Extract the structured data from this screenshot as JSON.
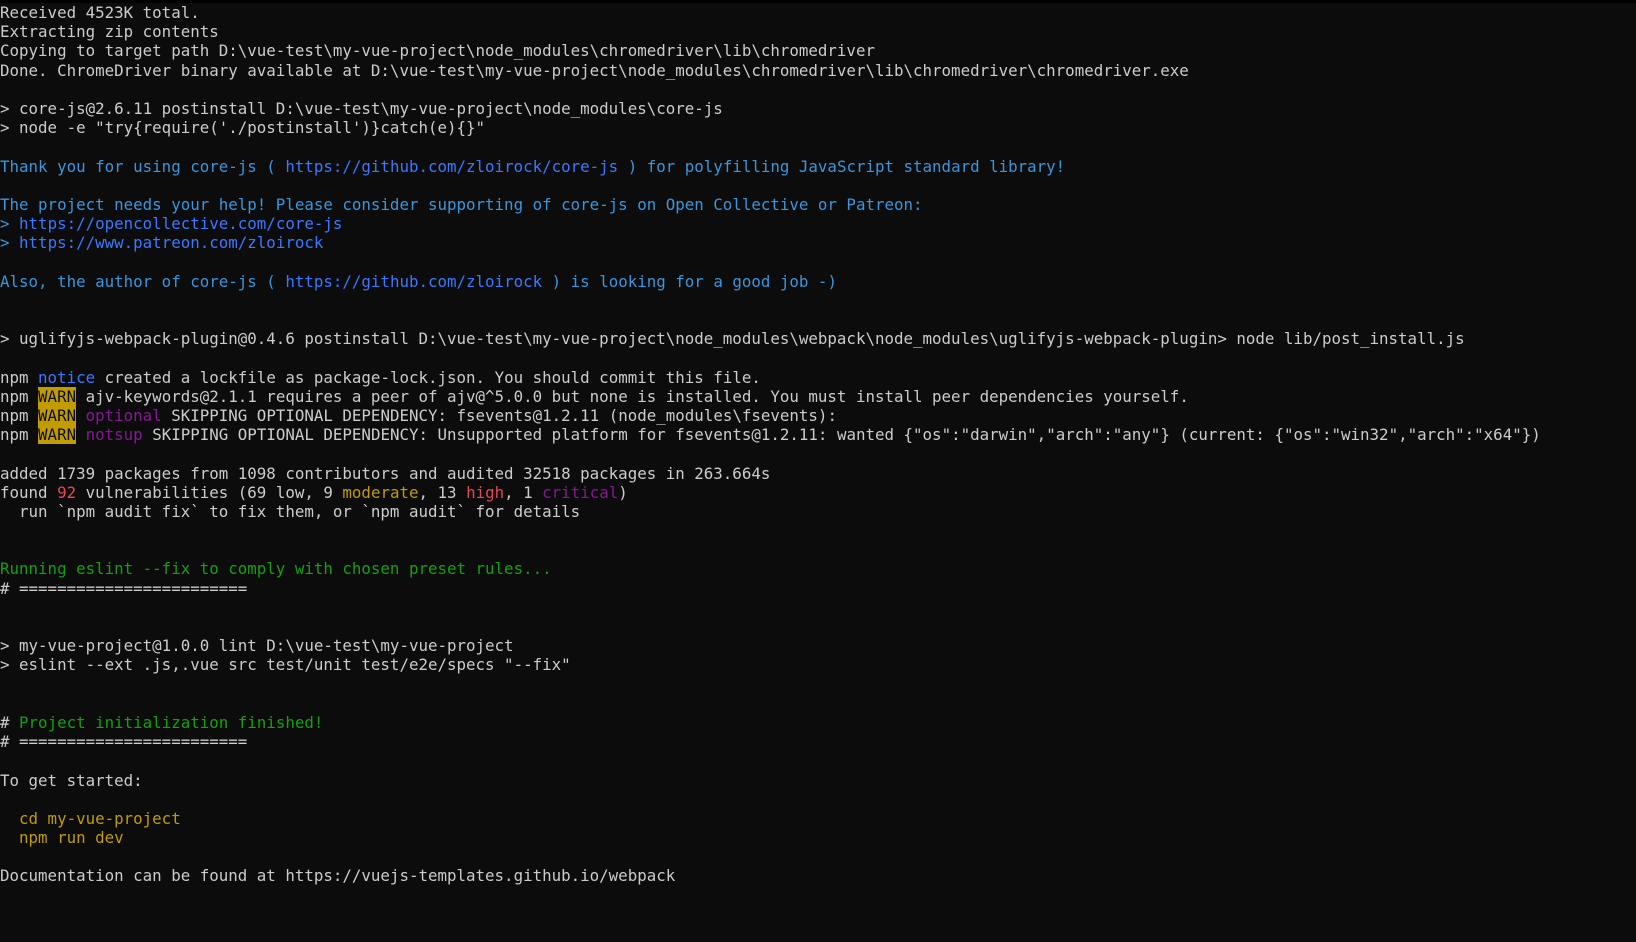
{
  "colors": {
    "background": "#0c0c0c",
    "default": "#cccccc",
    "cyan": "#3a96dd",
    "green": "#13a10e",
    "yellow": "#c19c00",
    "magenta": "#881798",
    "red": "#e74856",
    "notice": "#3b78ff"
  },
  "terminal": {
    "lines": [
      [
        {
          "t": "Received 4523K total.",
          "c": "default"
        }
      ],
      [
        {
          "t": "Extracting zip contents",
          "c": "default"
        }
      ],
      [
        {
          "t": "Copying to target path D:\\vue-test\\my-vue-project\\node_modules\\chromedriver\\lib\\chromedriver",
          "c": "default"
        }
      ],
      [
        {
          "t": "Done. ChromeDriver binary available at D:\\vue-test\\my-vue-project\\node_modules\\chromedriver\\lib\\chromedriver\\chromedriver.exe",
          "c": "default"
        }
      ],
      [],
      [
        {
          "t": "> core-js@2.6.11 postinstall D:\\vue-test\\my-vue-project\\node_modules\\core-js",
          "c": "default"
        }
      ],
      [
        {
          "t": "> node -e \"try{require('./postinstall')}catch(e){}\"",
          "c": "default"
        }
      ],
      [],
      [
        {
          "t": "Thank you for using core-js ( ",
          "c": "cyan"
        },
        {
          "t": "https://github.com/zloirock/core-js",
          "c": "notice"
        },
        {
          "t": " ) for polyfilling JavaScript standard library!",
          "c": "cyan"
        }
      ],
      [],
      [
        {
          "t": "The project needs your help! Please consider supporting of core-js on Open Collective or Patreon:",
          "c": "cyan"
        }
      ],
      [
        {
          "t": "> ",
          "c": "cyan"
        },
        {
          "t": "https://opencollective.com/core-js",
          "c": "notice"
        }
      ],
      [
        {
          "t": "> ",
          "c": "cyan"
        },
        {
          "t": "https://www.patreon.com/zloirock",
          "c": "notice"
        }
      ],
      [],
      [
        {
          "t": "Also, the author of core-js ( ",
          "c": "cyan"
        },
        {
          "t": "https://github.com/zloirock",
          "c": "notice"
        },
        {
          "t": " ) is looking for a good job -)",
          "c": "cyan"
        }
      ],
      [],
      [],
      [
        {
          "t": "> uglifyjs-webpack-plugin@0.4.6 postinstall D:\\vue-test\\my-vue-project\\node_modules\\webpack\\node_modules\\uglifyjs-webpack-plugin> node lib/post_install.js",
          "c": "default"
        }
      ],
      [],
      [
        {
          "t": "npm ",
          "c": "default"
        },
        {
          "t": "notice",
          "c": "notice"
        },
        {
          "t": " created a lockfile as package-lock.json. You should commit this file.",
          "c": "default"
        }
      ],
      [
        {
          "t": "npm ",
          "c": "default"
        },
        {
          "t": "WARN",
          "c": "warn"
        },
        {
          "t": " ajv-keywords@2.1.1 requires a peer of ajv@^5.0.0 but none is installed. You must install peer dependencies yourself.",
          "c": "default"
        }
      ],
      [
        {
          "t": "npm ",
          "c": "default"
        },
        {
          "t": "WARN",
          "c": "warn"
        },
        {
          "t": " ",
          "c": "default"
        },
        {
          "t": "optional",
          "c": "magenta"
        },
        {
          "t": " SKIPPING OPTIONAL DEPENDENCY: fsevents@1.2.11 (node_modules\\fsevents):",
          "c": "default"
        }
      ],
      [
        {
          "t": "npm ",
          "c": "default"
        },
        {
          "t": "WARN",
          "c": "warn"
        },
        {
          "t": " ",
          "c": "default"
        },
        {
          "t": "notsup",
          "c": "magenta"
        },
        {
          "t": " SKIPPING OPTIONAL DEPENDENCY: Unsupported platform for fsevents@1.2.11: wanted {\"os\":\"darwin\",\"arch\":\"any\"} (current: {\"os\":\"win32\",\"arch\":\"x64\"})",
          "c": "default"
        }
      ],
      [],
      [
        {
          "t": "added 1739 packages from 1098 contributors and audited 32518 packages in 263.664s",
          "c": "default"
        }
      ],
      [
        {
          "t": "found ",
          "c": "default"
        },
        {
          "t": "92",
          "c": "red"
        },
        {
          "t": " vulnerabilities (69 low, 9 ",
          "c": "default"
        },
        {
          "t": "moderate",
          "c": "yellow"
        },
        {
          "t": ", 13 ",
          "c": "default"
        },
        {
          "t": "high",
          "c": "red"
        },
        {
          "t": ", 1 ",
          "c": "default"
        },
        {
          "t": "critical",
          "c": "magenta"
        },
        {
          "t": ")",
          "c": "default"
        }
      ],
      [
        {
          "t": "  run `npm audit fix` to fix them, or `npm audit` for details",
          "c": "default"
        }
      ],
      [],
      [],
      [
        {
          "t": "Running eslint --fix to comply with chosen preset rules...",
          "c": "green"
        }
      ],
      [
        {
          "t": "# ========================",
          "c": "default"
        }
      ],
      [],
      [],
      [
        {
          "t": "> my-vue-project@1.0.0 lint D:\\vue-test\\my-vue-project",
          "c": "default"
        }
      ],
      [
        {
          "t": "> eslint --ext .js,.vue src test/unit test/e2e/specs \"--fix\"",
          "c": "default"
        }
      ],
      [],
      [],
      [
        {
          "t": "# ",
          "c": "default"
        },
        {
          "t": "Project initialization finished!",
          "c": "green"
        }
      ],
      [
        {
          "t": "# ========================",
          "c": "default"
        }
      ],
      [],
      [
        {
          "t": "To get started:",
          "c": "default"
        }
      ],
      [],
      [
        {
          "t": "  cd my-vue-project",
          "c": "yellow"
        }
      ],
      [
        {
          "t": "  npm run dev",
          "c": "yellow"
        }
      ],
      [],
      [
        {
          "t": "Documentation can be found at https://vuejs-templates.github.io/webpack",
          "c": "default"
        }
      ]
    ]
  }
}
